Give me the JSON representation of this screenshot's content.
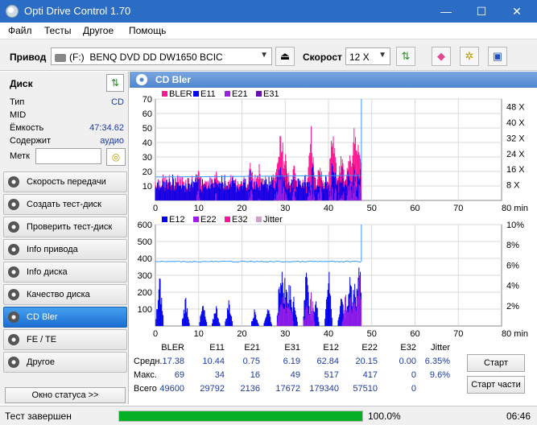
{
  "window": {
    "title": "Opti Drive Control 1.70",
    "minimize": "—",
    "maximize": "☐",
    "close": "✕"
  },
  "menu": [
    "Файл",
    "Тесты",
    "Другое",
    "Помощь"
  ],
  "toolbar": {
    "drive_label": "Привод",
    "drive_letter": "(F:)",
    "drive_name": "BENQ DVD DD DW1650 BCIC",
    "speed_label": "Скорост",
    "speed_value": "12 X"
  },
  "disk": {
    "header": "Диск",
    "fields": [
      {
        "key": "Тип",
        "value": "CD"
      },
      {
        "key": "MID",
        "value": ""
      },
      {
        "key": "Ёмкость",
        "value": "47:34.62"
      },
      {
        "key": "Содержит",
        "value": "аудио"
      }
    ],
    "label_key": "Метк",
    "label_value": ""
  },
  "nav": [
    {
      "label": "Скорость передачи",
      "active": false
    },
    {
      "label": "Создать тест-диск",
      "active": false
    },
    {
      "label": "Проверить тест-диск",
      "active": false
    },
    {
      "label": "Info привода",
      "active": false
    },
    {
      "label": "Info диска",
      "active": false
    },
    {
      "label": "Качество диска",
      "active": false
    },
    {
      "label": "CD Bler",
      "active": true
    },
    {
      "label": "FE / TE",
      "active": false
    },
    {
      "label": "Другое",
      "active": false
    }
  ],
  "status_window_button": "Окно статуса >>",
  "panel": {
    "title": "CD Bler"
  },
  "colors": {
    "bler": "#ff1493",
    "e11": "#0000ee",
    "e21": "#9b1fe8",
    "e31": "#6a0dad",
    "e12": "#0000ee",
    "e22": "#9b1fe8",
    "e32": "#ff1493",
    "jitter": "#c8a2c8",
    "speed": "#3399ff"
  },
  "chart_data": [
    {
      "type": "bar",
      "legend": [
        "BLER",
        "E11",
        "E21",
        "E31"
      ],
      "x_ticks": [
        "0",
        "10",
        "20",
        "30",
        "40",
        "50",
        "60",
        "70",
        "80 min"
      ],
      "y_ticks_left": [
        "70",
        "60",
        "50",
        "40",
        "30",
        "20",
        "10"
      ],
      "y_ticks_right": [
        "48 X",
        "40 X",
        "32 X",
        "24 X",
        "16 X",
        "8 X"
      ],
      "xlim": [
        0,
        80
      ],
      "ylim": [
        0,
        70
      ],
      "y2lim": [
        0,
        52
      ],
      "disc_end_min": 47.6,
      "speed_start_x": 12,
      "series_profile": {
        "bler_peaks": [
          [
            5,
            20
          ],
          [
            10,
            28
          ],
          [
            14,
            24
          ],
          [
            18,
            20
          ],
          [
            22,
            30
          ],
          [
            24,
            25
          ],
          [
            28,
            34
          ],
          [
            29,
            60
          ],
          [
            30,
            40
          ],
          [
            32,
            27
          ],
          [
            36,
            52
          ],
          [
            38,
            30
          ],
          [
            41,
            58
          ],
          [
            43,
            36
          ],
          [
            45,
            48
          ],
          [
            46,
            60
          ],
          [
            47,
            46
          ]
        ]
      }
    },
    {
      "type": "bar",
      "legend": [
        "E12",
        "E22",
        "E32",
        "Jitter"
      ],
      "x_ticks": [
        "0",
        "10",
        "20",
        "30",
        "40",
        "50",
        "60",
        "70",
        "80 min"
      ],
      "y_ticks_left": [
        "600",
        "500",
        "400",
        "300",
        "200",
        "100"
      ],
      "y_ticks_right": [
        "10%",
        "8%",
        "6%",
        "4%",
        "2%"
      ],
      "xlim": [
        0,
        80
      ],
      "ylim": [
        0,
        600
      ],
      "y2lim": [
        0,
        10
      ],
      "disc_end_min": 47.6,
      "jitter_level_pct": 6.35,
      "series_profile": {
        "e12_peaks": [
          [
            1,
            330
          ],
          [
            7,
            200
          ],
          [
            11,
            150
          ],
          [
            14,
            150
          ],
          [
            17,
            180
          ],
          [
            23,
            120
          ],
          [
            26,
            150
          ],
          [
            29,
            460
          ],
          [
            30,
            340
          ],
          [
            31,
            310
          ],
          [
            32,
            200
          ],
          [
            35,
            440
          ],
          [
            37,
            200
          ],
          [
            40,
            400
          ],
          [
            43,
            220
          ],
          [
            45,
            360
          ],
          [
            46,
            330
          ],
          [
            47,
            517
          ]
        ],
        "e22_peaks": [
          [
            29,
            270
          ],
          [
            30,
            220
          ],
          [
            31,
            300
          ],
          [
            35,
            180
          ],
          [
            36,
            240
          ],
          [
            44,
            230
          ],
          [
            45,
            290
          ],
          [
            46,
            230
          ],
          [
            47,
            417
          ]
        ]
      }
    }
  ],
  "stats": {
    "headers": [
      "BLER",
      "E11",
      "E21",
      "E31",
      "E12",
      "E22",
      "E32",
      "Jitter"
    ],
    "rows": [
      {
        "label": "Средн.",
        "values": [
          "17.38",
          "10.44",
          "0.75",
          "6.19",
          "62.84",
          "20.15",
          "0.00",
          "6.35%"
        ]
      },
      {
        "label": "Макс.",
        "values": [
          "69",
          "34",
          "16",
          "49",
          "517",
          "417",
          "0",
          "9.6%"
        ]
      },
      {
        "label": "Всего",
        "values": [
          "49600",
          "29792",
          "2136",
          "17672",
          "179340",
          "57510",
          "0",
          ""
        ]
      }
    ]
  },
  "buttons": {
    "start": "Старт",
    "start_part": "Старт части"
  },
  "statusbar": {
    "text": "Тест завершен",
    "progress_pct": 100,
    "progress_label": "100.0%",
    "time": "06:46"
  }
}
